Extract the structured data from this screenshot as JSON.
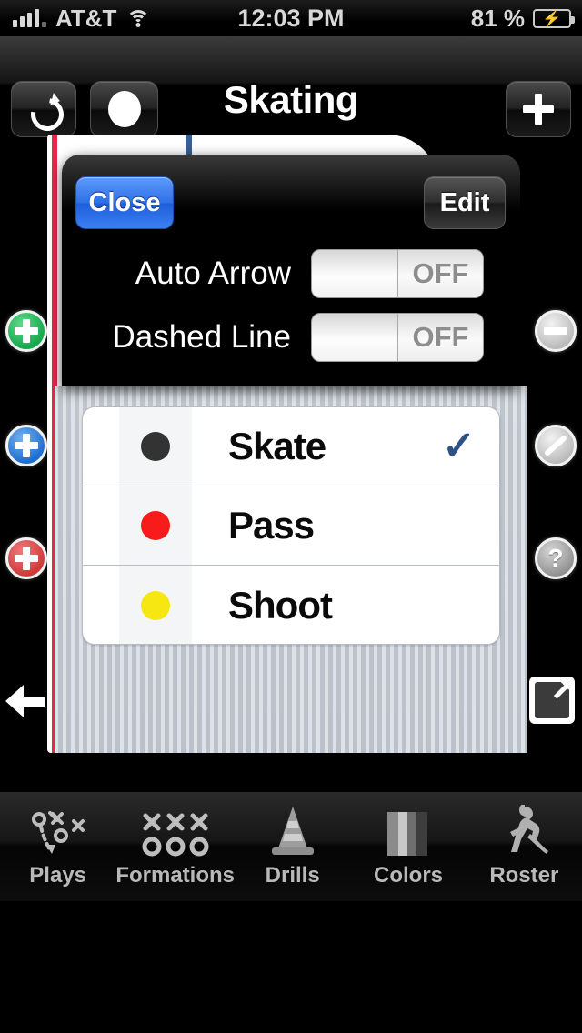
{
  "statusbar": {
    "carrier": "AT&T",
    "time": "12:03 PM",
    "battery_percent": "81 %",
    "signal_icon": "signal-bars-icon",
    "wifi_icon": "wifi-icon",
    "battery_icon": "battery-charging-icon"
  },
  "navbar": {
    "title": "Skating",
    "redo_icon": "redo-arrow-icon",
    "puck_icon": "puck-circle-icon",
    "add_icon": "plus-icon"
  },
  "modal": {
    "close_label": "Close",
    "edit_label": "Edit",
    "settings": [
      {
        "label": "Auto Arrow",
        "value": "OFF",
        "state": "off"
      },
      {
        "label": "Dashed Line",
        "value": "OFF",
        "state": "off"
      }
    ]
  },
  "list": {
    "rows": [
      {
        "label": "Skate",
        "color": "#333333",
        "selected": true,
        "check": "✓"
      },
      {
        "label": "Pass",
        "color": "#f71b1b",
        "selected": false,
        "check": ""
      },
      {
        "label": "Shoot",
        "color": "#f6e713",
        "selected": false,
        "check": ""
      }
    ]
  },
  "side_controls": {
    "left": [
      {
        "name": "add-green-player",
        "icon": "plus-circle-icon",
        "color": "#17a94e"
      },
      {
        "name": "add-blue-player",
        "icon": "plus-circle-icon",
        "color": "#1f6fd0"
      },
      {
        "name": "add-red-player",
        "icon": "plus-circle-icon",
        "color": "#cf3b3b"
      }
    ],
    "right": [
      {
        "name": "remove-button",
        "icon": "minus-circle-icon"
      },
      {
        "name": "line-tool",
        "icon": "line-circle-icon"
      },
      {
        "name": "help-button",
        "icon": "question-mark-circle-icon"
      }
    ],
    "back_icon": "back-arrow-icon",
    "share_icon": "share-export-icon"
  },
  "tabbar": {
    "tabs": [
      {
        "label": "Plays",
        "icon": "plays-diagram-icon"
      },
      {
        "label": "Formations",
        "icon": "formations-xo-icon"
      },
      {
        "label": "Drills",
        "icon": "cone-icon"
      },
      {
        "label": "Colors",
        "icon": "color-bars-icon"
      },
      {
        "label": "Roster",
        "icon": "hockey-player-icon"
      }
    ]
  },
  "colors": {
    "accent_blue": "#2f6fe8",
    "check_blue": "#2e5288",
    "goal_line_red": "#e8274b",
    "blue_line": "#38618f"
  }
}
